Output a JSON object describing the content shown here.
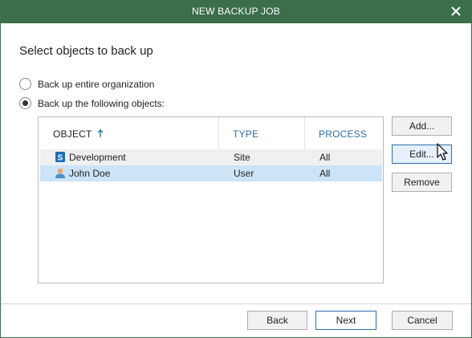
{
  "window": {
    "title": "NEW BACKUP JOB"
  },
  "page": {
    "heading": "Select objects to back up"
  },
  "options": {
    "entire_org": "Back up entire organization",
    "following": "Back up the following objects:"
  },
  "table": {
    "columns": {
      "object": "OBJECT",
      "type": "TYPE",
      "process": "PROCESS"
    },
    "rows": [
      {
        "object": "Development",
        "type": "Site",
        "process": "All",
        "icon": "sharepoint-site-icon"
      },
      {
        "object": "John Doe",
        "type": "User",
        "process": "All",
        "icon": "user-icon"
      }
    ]
  },
  "side_buttons": {
    "add": "Add...",
    "edit": "Edit...",
    "remove": "Remove"
  },
  "footer": {
    "back": "Back",
    "next": "Next",
    "cancel": "Cancel"
  },
  "colors": {
    "titlebar": "#3b6e4a",
    "header_text": "#2e6fa8",
    "selected_row": "#cce4f7",
    "hover_row": "#f0f0f0"
  }
}
